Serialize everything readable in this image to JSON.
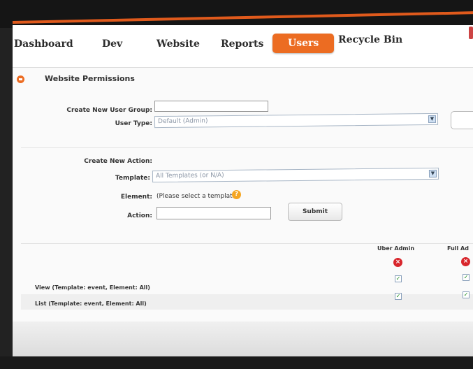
{
  "nav": {
    "items": [
      "Dashboard",
      "Dev",
      "Website",
      "Reports",
      "Users",
      "Recycle Bin"
    ],
    "active": "Users"
  },
  "section": {
    "title": "Website Permissions"
  },
  "form_group": {
    "create_group_label": "Create New User Group:",
    "user_type_label": "User Type:",
    "user_type_value": "Default (Admin)"
  },
  "form_action": {
    "create_action_label": "Create New Action:",
    "template_label": "Template:",
    "template_value": "All Templates (or N/A)",
    "element_label": "Element:",
    "element_value": "(Please select a template)",
    "action_label": "Action:",
    "submit_label": "Submit"
  },
  "table": {
    "columns": [
      "Uber Admin",
      "Full Ad"
    ],
    "rows": [
      {
        "label": "View (Template: event, Element: All)",
        "values": [
          true,
          true
        ]
      },
      {
        "label": "List (Template: event, Element: All)",
        "values": [
          true,
          true
        ]
      }
    ]
  },
  "colors": {
    "accent": "#ec6c22",
    "delete": "#d8262c",
    "check": "#1a8a1a"
  },
  "icons": {
    "section": "collapse-icon",
    "info": "info-icon",
    "delete": "delete-icon",
    "check": "checkbox-icon"
  }
}
